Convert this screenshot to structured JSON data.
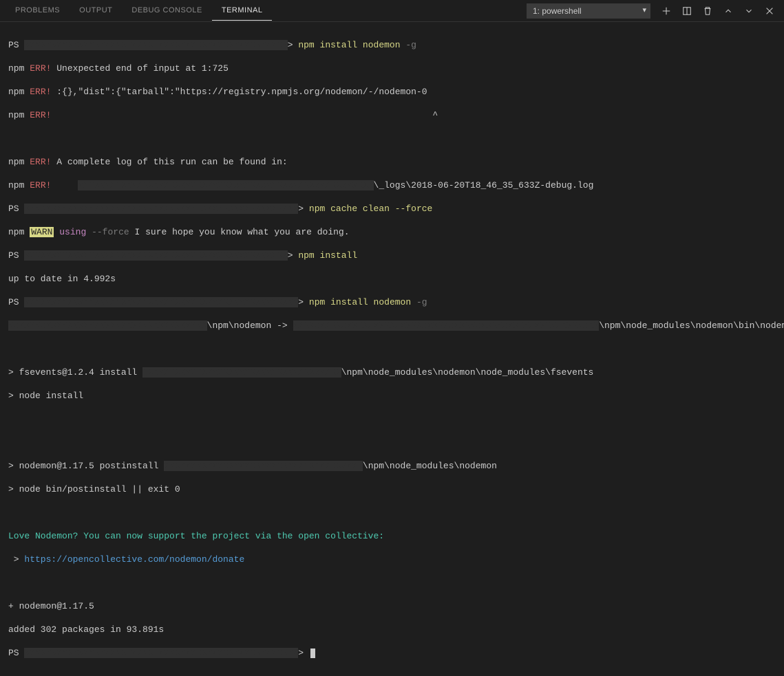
{
  "tabs": {
    "problems": "PROBLEMS",
    "output": "OUTPUT",
    "debug": "DEBUG CONSOLE",
    "terminal": "TERMINAL"
  },
  "terminal_selector": "1: powershell",
  "lines": {
    "l1_ps": "PS",
    "l1_gt": ">",
    "l1_cmd": "npm install nodemon",
    "l1_flag": "-g",
    "l2_npm": "npm",
    "l2_err": "ERR!",
    "l2_msg": "Unexpected end of input at 1:725",
    "l3_npm": "npm",
    "l3_err": "ERR!",
    "l3_msg": ":{},\"dist\":{\"tarball\":\"https://registry.npmjs.org/nodemon/-/nodemon-0",
    "l4_npm": "npm",
    "l4_err": "ERR!",
    "l4_caret": "                                                                      ^",
    "l6_npm": "npm",
    "l6_err": "ERR!",
    "l6_msg": "A complete log of this run can be found in:",
    "l7_npm": "npm",
    "l7_err": "ERR!",
    "l7_path": "\\_logs\\2018-06-20T18_46_35_633Z-debug.log",
    "l8_ps": "PS",
    "l8_gt": ">",
    "l8_cmd": "npm cache clean --force",
    "l9_npm": "npm",
    "l9_warn": "WARN",
    "l9_using": "using",
    "l9_force": "--force",
    "l9_rest": " I sure hope you know what you are doing.",
    "l10_ps": "PS",
    "l10_gt": ">",
    "l10_cmd": "npm install",
    "l11": "up to date in 4.992s",
    "l12_ps": "PS",
    "l12_gt": ">",
    "l12_cmd": "npm install nodemon",
    "l12_flag": "-g",
    "l13_a": "\\npm\\nodemon ->",
    "l13_b": "\\npm\\node_modules\\nodemon\\bin\\nodemon.js",
    "l15_a": "> fsevents@1.2.4 install",
    "l15_b": "\\npm\\node_modules\\nodemon\\node_modules\\fsevents",
    "l16": "> node install",
    "l18_a": "> nodemon@1.17.5 postinstall",
    "l18_b": "\\npm\\node_modules\\nodemon",
    "l19": "> node bin/postinstall || exit 0",
    "l21": "Love Nodemon? You can now support the project via the open collective:",
    "l22_a": " > ",
    "l22_b": "https://opencollective.com/nodemon/donate",
    "l24": "+ nodemon@1.17.5",
    "l25": "added 302 packages in 93.891s",
    "l26_ps": "PS",
    "l26_gt": ">"
  }
}
